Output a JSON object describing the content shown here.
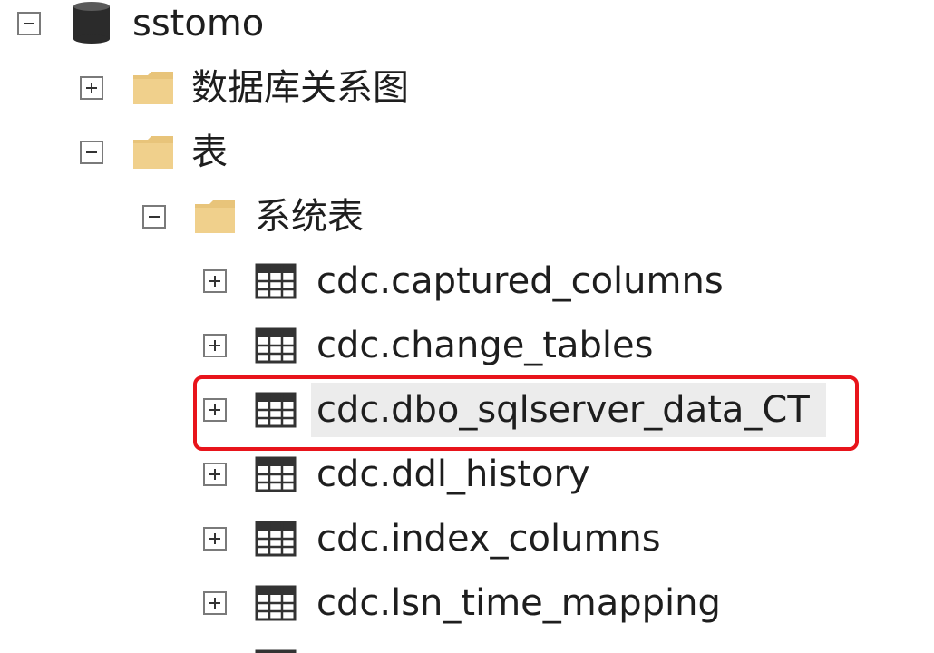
{
  "tree": {
    "server_node": {
      "label": "sstomo",
      "expanded": true,
      "icon": "database-icon"
    },
    "database_diagrams": {
      "label": "数据库关系图",
      "expanded": false,
      "icon": "folder-icon"
    },
    "tables_folder": {
      "label": "表",
      "expanded": true,
      "icon": "folder-icon"
    },
    "system_tables_folder": {
      "label": "系统表",
      "expanded": true,
      "icon": "folder-icon"
    },
    "tables": [
      {
        "label": "cdc.captured_columns",
        "icon": "table-icon",
        "expanded": false
      },
      {
        "label": "cdc.change_tables",
        "icon": "table-icon",
        "expanded": false
      },
      {
        "label": "cdc.dbo_sqlserver_data_CT",
        "icon": "table-icon",
        "expanded": false,
        "selected": true,
        "highlighted": true
      },
      {
        "label": "cdc.ddl_history",
        "icon": "table-icon",
        "expanded": false
      },
      {
        "label": "cdc.index_columns",
        "icon": "table-icon",
        "expanded": false
      },
      {
        "label": "cdc.lsn_time_mapping",
        "icon": "table-icon",
        "expanded": false
      }
    ]
  },
  "colors": {
    "folder": "#e8c47a",
    "highlight_border": "#e8141b",
    "selection_bg": "#ececec"
  }
}
